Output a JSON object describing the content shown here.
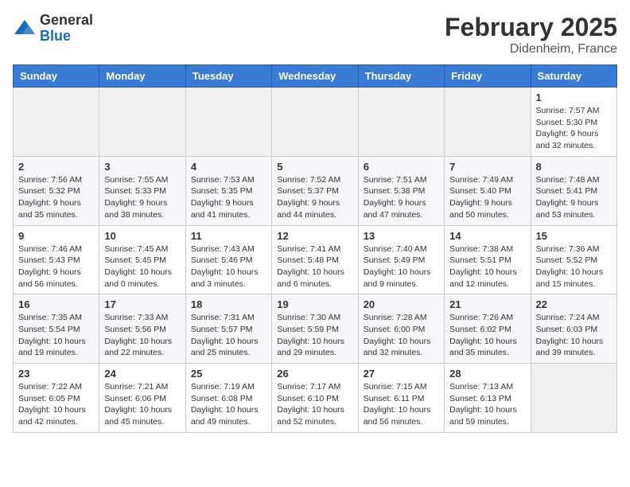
{
  "header": {
    "logo_general": "General",
    "logo_blue": "Blue",
    "month_title": "February 2025",
    "location": "Didenheim, France"
  },
  "calendar": {
    "days_of_week": [
      "Sunday",
      "Monday",
      "Tuesday",
      "Wednesday",
      "Thursday",
      "Friday",
      "Saturday"
    ],
    "weeks": [
      [
        {
          "day": "",
          "info": ""
        },
        {
          "day": "",
          "info": ""
        },
        {
          "day": "",
          "info": ""
        },
        {
          "day": "",
          "info": ""
        },
        {
          "day": "",
          "info": ""
        },
        {
          "day": "",
          "info": ""
        },
        {
          "day": "1",
          "info": "Sunrise: 7:57 AM\nSunset: 5:30 PM\nDaylight: 9 hours and 32 minutes."
        }
      ],
      [
        {
          "day": "2",
          "info": "Sunrise: 7:56 AM\nSunset: 5:32 PM\nDaylight: 9 hours and 35 minutes."
        },
        {
          "day": "3",
          "info": "Sunrise: 7:55 AM\nSunset: 5:33 PM\nDaylight: 9 hours and 38 minutes."
        },
        {
          "day": "4",
          "info": "Sunrise: 7:53 AM\nSunset: 5:35 PM\nDaylight: 9 hours and 41 minutes."
        },
        {
          "day": "5",
          "info": "Sunrise: 7:52 AM\nSunset: 5:37 PM\nDaylight: 9 hours and 44 minutes."
        },
        {
          "day": "6",
          "info": "Sunrise: 7:51 AM\nSunset: 5:38 PM\nDaylight: 9 hours and 47 minutes."
        },
        {
          "day": "7",
          "info": "Sunrise: 7:49 AM\nSunset: 5:40 PM\nDaylight: 9 hours and 50 minutes."
        },
        {
          "day": "8",
          "info": "Sunrise: 7:48 AM\nSunset: 5:41 PM\nDaylight: 9 hours and 53 minutes."
        }
      ],
      [
        {
          "day": "9",
          "info": "Sunrise: 7:46 AM\nSunset: 5:43 PM\nDaylight: 9 hours and 56 minutes."
        },
        {
          "day": "10",
          "info": "Sunrise: 7:45 AM\nSunset: 5:45 PM\nDaylight: 10 hours and 0 minutes."
        },
        {
          "day": "11",
          "info": "Sunrise: 7:43 AM\nSunset: 5:46 PM\nDaylight: 10 hours and 3 minutes."
        },
        {
          "day": "12",
          "info": "Sunrise: 7:41 AM\nSunset: 5:48 PM\nDaylight: 10 hours and 6 minutes."
        },
        {
          "day": "13",
          "info": "Sunrise: 7:40 AM\nSunset: 5:49 PM\nDaylight: 10 hours and 9 minutes."
        },
        {
          "day": "14",
          "info": "Sunrise: 7:38 AM\nSunset: 5:51 PM\nDaylight: 10 hours and 12 minutes."
        },
        {
          "day": "15",
          "info": "Sunrise: 7:36 AM\nSunset: 5:52 PM\nDaylight: 10 hours and 15 minutes."
        }
      ],
      [
        {
          "day": "16",
          "info": "Sunrise: 7:35 AM\nSunset: 5:54 PM\nDaylight: 10 hours and 19 minutes."
        },
        {
          "day": "17",
          "info": "Sunrise: 7:33 AM\nSunset: 5:56 PM\nDaylight: 10 hours and 22 minutes."
        },
        {
          "day": "18",
          "info": "Sunrise: 7:31 AM\nSunset: 5:57 PM\nDaylight: 10 hours and 25 minutes."
        },
        {
          "day": "19",
          "info": "Sunrise: 7:30 AM\nSunset: 5:59 PM\nDaylight: 10 hours and 29 minutes."
        },
        {
          "day": "20",
          "info": "Sunrise: 7:28 AM\nSunset: 6:00 PM\nDaylight: 10 hours and 32 minutes."
        },
        {
          "day": "21",
          "info": "Sunrise: 7:26 AM\nSunset: 6:02 PM\nDaylight: 10 hours and 35 minutes."
        },
        {
          "day": "22",
          "info": "Sunrise: 7:24 AM\nSunset: 6:03 PM\nDaylight: 10 hours and 39 minutes."
        }
      ],
      [
        {
          "day": "23",
          "info": "Sunrise: 7:22 AM\nSunset: 6:05 PM\nDaylight: 10 hours and 42 minutes."
        },
        {
          "day": "24",
          "info": "Sunrise: 7:21 AM\nSunset: 6:06 PM\nDaylight: 10 hours and 45 minutes."
        },
        {
          "day": "25",
          "info": "Sunrise: 7:19 AM\nSunset: 6:08 PM\nDaylight: 10 hours and 49 minutes."
        },
        {
          "day": "26",
          "info": "Sunrise: 7:17 AM\nSunset: 6:10 PM\nDaylight: 10 hours and 52 minutes."
        },
        {
          "day": "27",
          "info": "Sunrise: 7:15 AM\nSunset: 6:11 PM\nDaylight: 10 hours and 56 minutes."
        },
        {
          "day": "28",
          "info": "Sunrise: 7:13 AM\nSunset: 6:13 PM\nDaylight: 10 hours and 59 minutes."
        },
        {
          "day": "",
          "info": ""
        }
      ]
    ]
  }
}
